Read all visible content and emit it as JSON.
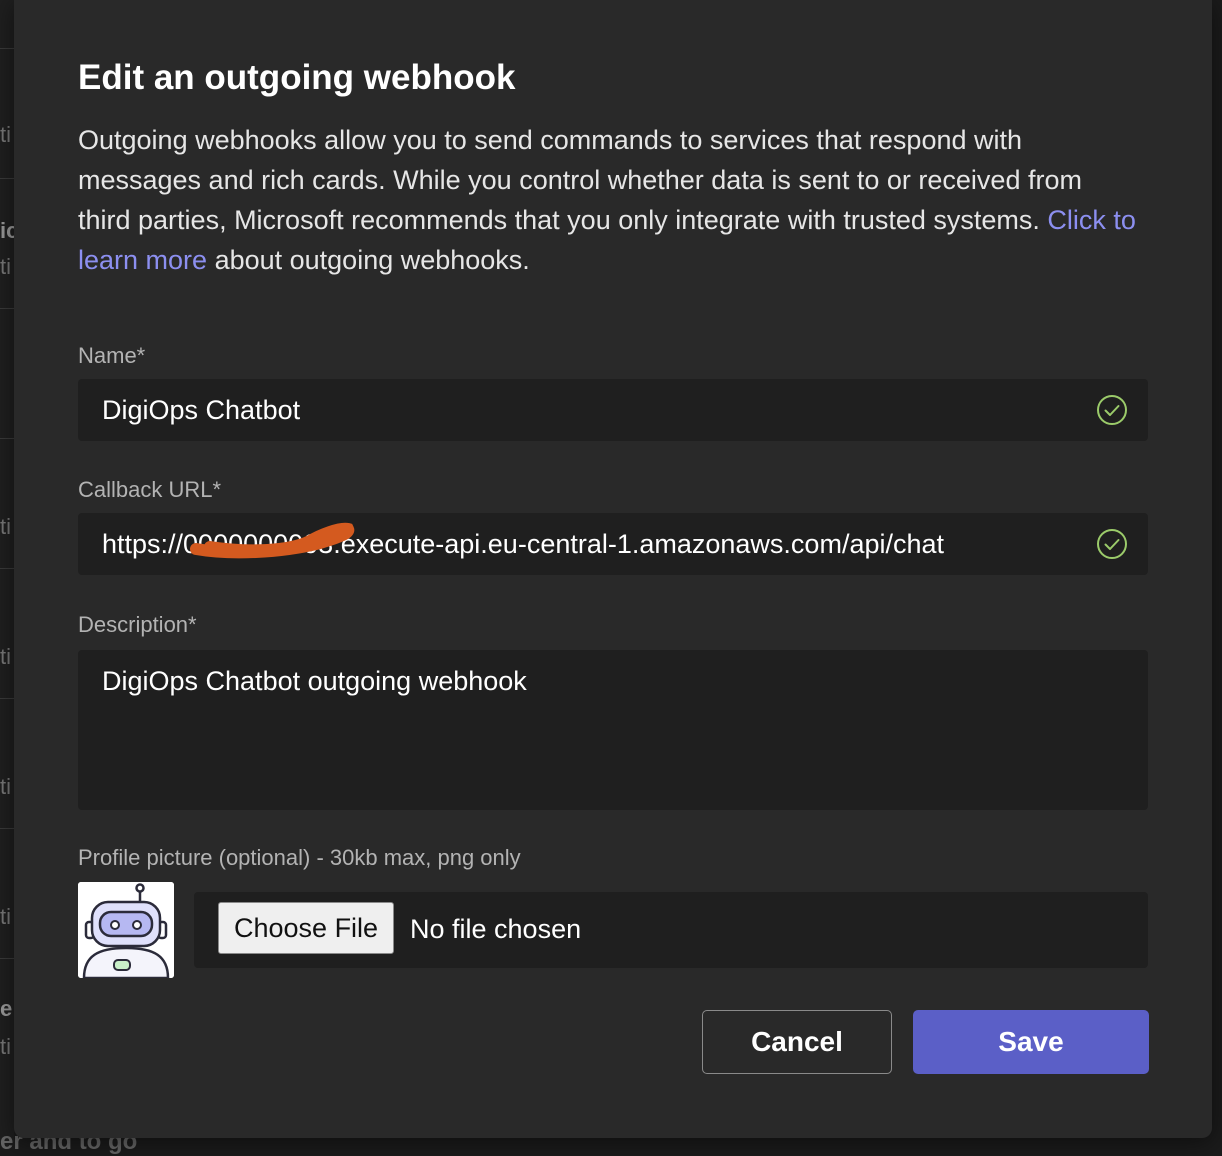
{
  "background": {
    "fragments": [
      "ti",
      "ic",
      "ti",
      "ti",
      "ti",
      "ti",
      "ti",
      "ti",
      "e",
      "ti"
    ],
    "bottom_text": "er and to go"
  },
  "dialog": {
    "title": "Edit an outgoing webhook",
    "description_before_link": "Outgoing webhooks allow you to send commands to services that respond with messages and rich cards. While you control whether data is sent to or received from third parties, Microsoft recommends that you only integrate with trusted systems. ",
    "learn_more_link": "Click to learn more",
    "description_after_link": " about outgoing webhooks.",
    "name": {
      "label": "Name*",
      "value": "DigiOps Chatbot",
      "valid_icon": "check-circle-icon"
    },
    "callback_url": {
      "label": "Callback URL*",
      "value": "https://0000000003.execute-api.eu-central-1.amazonaws.com/api/chat",
      "valid_icon": "check-circle-icon"
    },
    "description": {
      "label": "Description*",
      "value": "DigiOps Chatbot outgoing webhook"
    },
    "profile_picture": {
      "label": "Profile picture (optional) - 30kb max, png only",
      "choose_file_label": "Choose File",
      "file_status": "No file chosen"
    },
    "cancel_label": "Cancel",
    "save_label": "Save"
  },
  "colors": {
    "accent": "#5b5fc7",
    "link": "#8c8ff0",
    "valid": "#9bcb6a",
    "redaction": "#d45a1f"
  }
}
